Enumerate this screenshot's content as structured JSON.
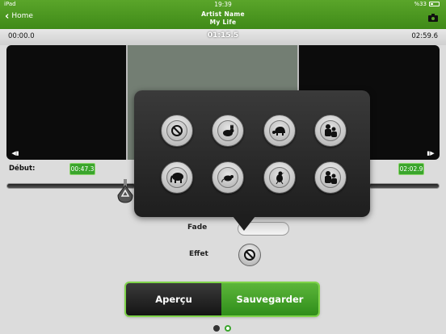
{
  "status_bar": {
    "device": "iPad",
    "time": "19:39",
    "battery": "%33"
  },
  "nav": {
    "back_label": "Home",
    "artist": "Artist Name",
    "song": "My Life"
  },
  "times": {
    "start": "00:00.0",
    "current": "01:15.5",
    "end": "02:59.6"
  },
  "trim": {
    "start_label": "Début:",
    "start_time": "00:47.3",
    "end_time": "02:02.9"
  },
  "effects": [
    {
      "name": "none-icon"
    },
    {
      "name": "rabbit-icon"
    },
    {
      "name": "turtle-icon"
    },
    {
      "name": "crowd-icon"
    },
    {
      "name": "elephant-icon"
    },
    {
      "name": "mouse-icon"
    },
    {
      "name": "bird-icon"
    },
    {
      "name": "crowd-icon"
    }
  ],
  "fade_label": "Fade",
  "effet_label": "Effet",
  "buttons": {
    "preview": "Aperçu",
    "save": "Sauvegarder"
  },
  "page_indicator": {
    "count": 2,
    "active": 2
  },
  "colors": {
    "accent": "#3f8a18",
    "wave": "#6fd23a"
  }
}
